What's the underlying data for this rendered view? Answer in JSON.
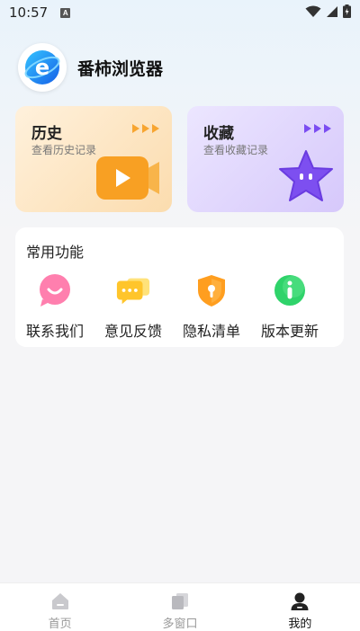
{
  "status_bar": {
    "time": "10:57",
    "notice": "A"
  },
  "header": {
    "app_title": "番柿浏览器",
    "logo_letter": "e"
  },
  "cards": [
    {
      "title": "历史",
      "subtitle": "查看历史记录",
      "accent": "#f7a530",
      "icon": "video-play-icon"
    },
    {
      "title": "收藏",
      "subtitle": "查看收藏记录",
      "accent": "#7b4df2",
      "icon": "star-icon"
    }
  ],
  "functions": {
    "title": "常用功能",
    "items": [
      {
        "label": "联系我们",
        "icon": "chat-smile-icon",
        "color": "#ff6fa3"
      },
      {
        "label": "意见反馈",
        "icon": "feedback-icon",
        "color": "#ffcf35"
      },
      {
        "label": "隐私清单",
        "icon": "shield-lock-icon",
        "color": "#ff9f1a"
      },
      {
        "label": "版本更新",
        "icon": "info-icon",
        "color": "#2fd36a"
      }
    ]
  },
  "nav": {
    "items": [
      {
        "label": "首页",
        "icon": "home-icon",
        "active": false
      },
      {
        "label": "多窗口",
        "icon": "windows-icon",
        "active": false
      },
      {
        "label": "我的",
        "icon": "profile-icon",
        "active": true
      }
    ]
  }
}
